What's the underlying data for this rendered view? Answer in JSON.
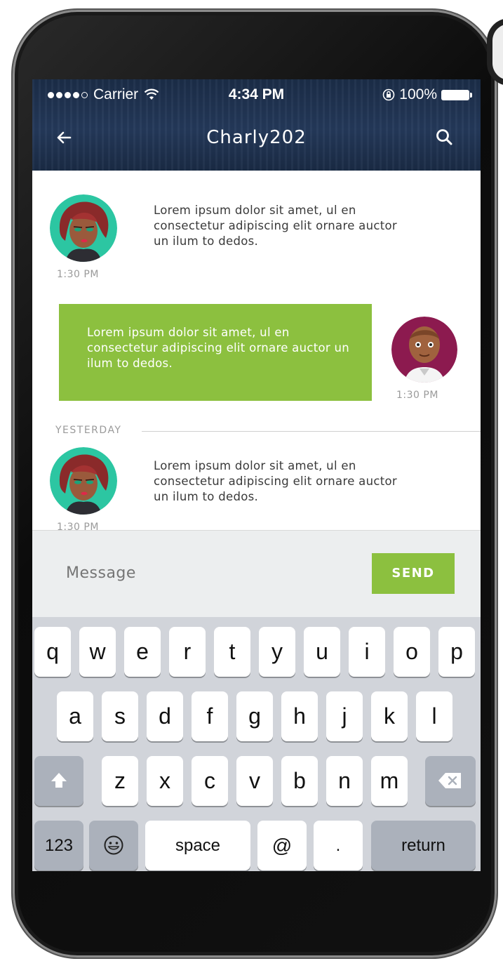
{
  "status_bar": {
    "carrier": "Carrier",
    "time": "4:34 PM",
    "battery": "100%"
  },
  "nav": {
    "title": "Charly202",
    "back_icon": "arrow-left-icon",
    "search_icon": "search-icon"
  },
  "messages": [
    {
      "text": "Lorem ipsum dolor sit amet, ul en consectetur adipiscing elit ornare auctor  un ilum to dedos.",
      "time": "1:30 PM"
    },
    {
      "text": "Lorem ipsum dolor sit amet, ul en consectetur adipiscing elit ornare auctor  un ilum to dedos.",
      "time": "1:30 PM"
    },
    {
      "text": "Lorem ipsum dolor sit amet, ul en consectetur adipiscing elit ornare auctor  un ilum to dedos.",
      "time": "1:30 PM"
    }
  ],
  "divider": {
    "label": "YESTERDAY"
  },
  "composer": {
    "placeholder": "Message",
    "send_label": "SEND"
  },
  "keyboard": {
    "row1": [
      "q",
      "w",
      "e",
      "r",
      "t",
      "y",
      "u",
      "i",
      "o",
      "p"
    ],
    "row2": [
      "a",
      "s",
      "d",
      "f",
      "g",
      "h",
      "j",
      "k",
      "l"
    ],
    "row3": [
      "z",
      "x",
      "c",
      "v",
      "b",
      "n",
      "m"
    ],
    "numbers_label": "123",
    "space_label": "space",
    "at_label": "@",
    "dot_label": ".",
    "return_label": "return"
  },
  "colors": {
    "accent": "#8cc03f",
    "header": "#1f3250",
    "avatar_teal": "#2cc6a2",
    "avatar_magenta": "#8c1a4f"
  }
}
